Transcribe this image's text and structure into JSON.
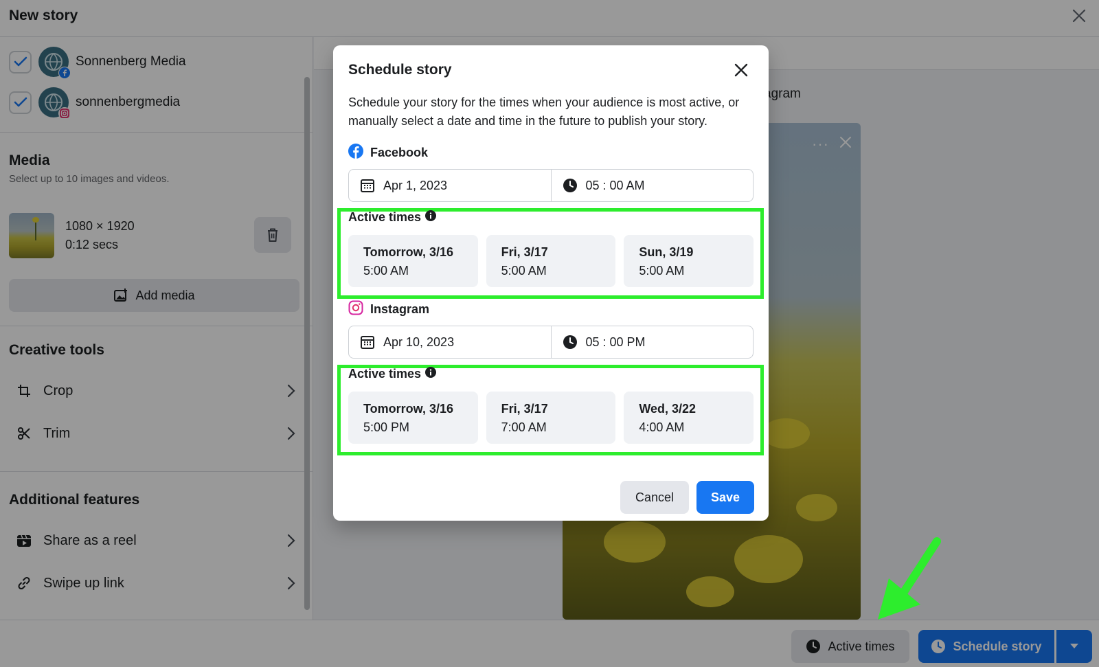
{
  "window": {
    "title": "New story"
  },
  "accounts": [
    {
      "name": "Sonnenberg Media",
      "platform": "facebook",
      "checked": true
    },
    {
      "name": "sonnenbergmedia",
      "platform": "instagram",
      "checked": true
    }
  ],
  "media": {
    "title": "Media",
    "subtitle": "Select up to 10 images and videos.",
    "item": {
      "dimensions": "1080 × 1920",
      "duration": "0:12 secs"
    },
    "add_label": "Add media"
  },
  "creative_tools": {
    "title": "Creative tools",
    "items": [
      {
        "label": "Crop",
        "icon": "crop-icon"
      },
      {
        "label": "Trim",
        "icon": "scissors-icon"
      }
    ]
  },
  "additional_features": {
    "title": "Additional features",
    "items": [
      {
        "label": "Share as a reel",
        "icon": "reel-icon"
      },
      {
        "label": "Swipe up link",
        "icon": "link-icon"
      }
    ]
  },
  "preview": {
    "partial_label": "agram"
  },
  "bottom": {
    "active_times_label": "Active times",
    "schedule_label": "Schedule story"
  },
  "modal": {
    "title": "Schedule story",
    "description": "Schedule your story for the times when your audience is most active, or manually select a date and time in the future to publish your story.",
    "facebook": {
      "label": "Facebook",
      "date": "Apr 1, 2023",
      "time": "05 : 00 AM",
      "active_title": "Active times",
      "slots": [
        {
          "day": "Tomorrow, 3/16",
          "time": "5:00 AM"
        },
        {
          "day": "Fri, 3/17",
          "time": "5:00 AM"
        },
        {
          "day": "Sun, 3/19",
          "time": "5:00 AM"
        }
      ]
    },
    "instagram": {
      "label": "Instagram",
      "date": "Apr 10, 2023",
      "time": "05 : 00 PM",
      "active_title": "Active times",
      "slots": [
        {
          "day": "Tomorrow, 3/16",
          "time": "5:00 PM"
        },
        {
          "day": "Fri, 3/17",
          "time": "7:00 AM"
        },
        {
          "day": "Wed, 3/22",
          "time": "4:00 AM"
        }
      ]
    },
    "cancel_label": "Cancel",
    "save_label": "Save"
  },
  "colors": {
    "accent": "#1877f2",
    "highlight": "#2ded2d",
    "scrim": "rgba(0,0,0,0.40)"
  }
}
